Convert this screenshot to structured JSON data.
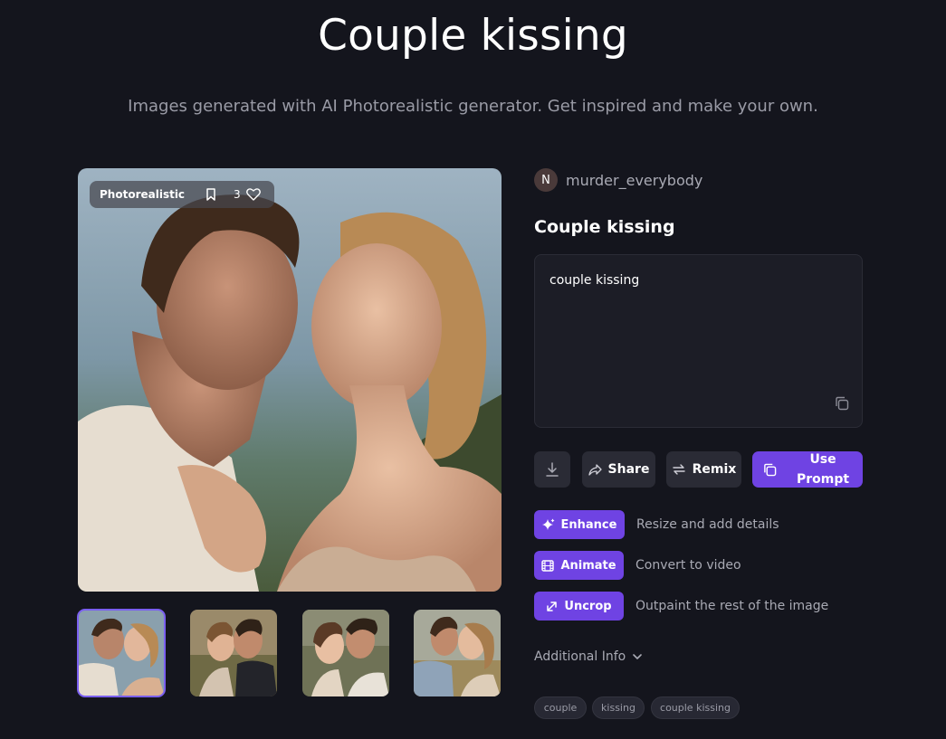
{
  "header": {
    "title": "Couple kissing",
    "subtitle": "Images generated with AI Photorealistic generator. Get inspired and make your own."
  },
  "image": {
    "style_badge": "Photorealistic",
    "likes": "3"
  },
  "author": {
    "initial": "N",
    "name": "murder_everybody"
  },
  "details": {
    "title": "Couple kissing",
    "prompt": "couple kissing"
  },
  "buttons": {
    "share": "Share",
    "remix": "Remix",
    "use_prompt_line1": "Use",
    "use_prompt_line2": "Prompt"
  },
  "actions": [
    {
      "label": "Enhance",
      "description": "Resize and add details",
      "icon": "sparkle-icon"
    },
    {
      "label": "Animate",
      "description": "Convert to video",
      "icon": "film-icon"
    },
    {
      "label": "Uncrop",
      "description": "Outpaint the rest of the image",
      "icon": "expand-icon"
    }
  ],
  "additional_info": "Additional Info",
  "tags": [
    "couple",
    "kissing",
    "couple kissing"
  ],
  "colors": {
    "background": "#14151d",
    "accent": "#6f43e3"
  }
}
